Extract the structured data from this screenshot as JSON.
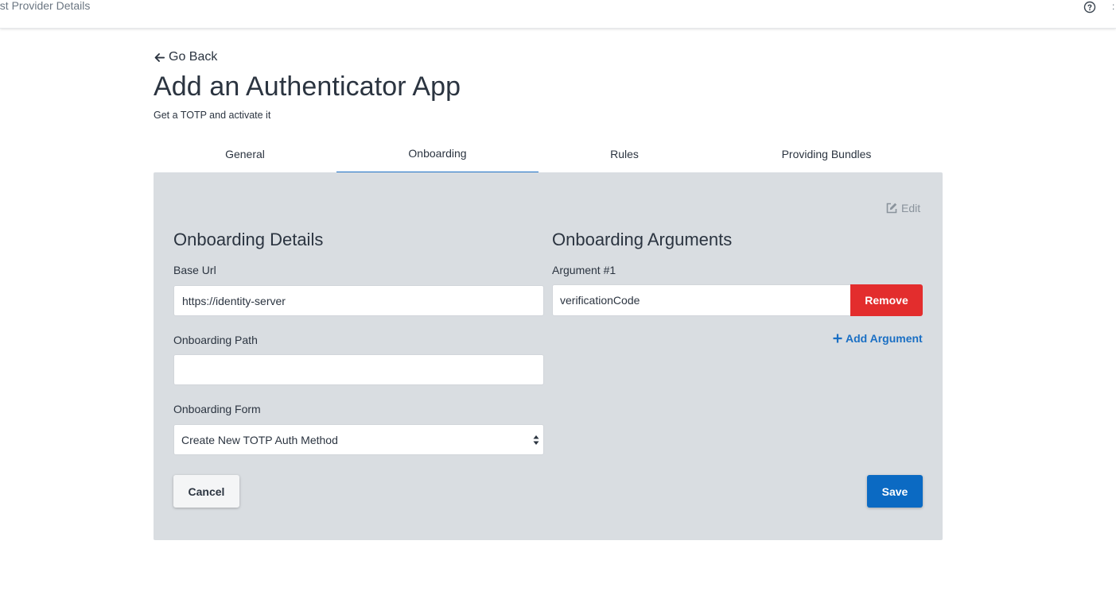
{
  "topbar": {
    "title": "ust Provider Details",
    "help_icon": "question-circle-icon",
    "edge_glyph": ":"
  },
  "header": {
    "go_back_label": "Go Back",
    "title": "Add an Authenticator App",
    "subtitle": "Get a TOTP and activate it"
  },
  "tabs": [
    {
      "label": "General",
      "active": false
    },
    {
      "label": "Onboarding",
      "active": true
    },
    {
      "label": "Rules",
      "active": false
    },
    {
      "label": "Providing Bundles",
      "active": false
    }
  ],
  "panel": {
    "edit_label": "Edit",
    "details": {
      "title": "Onboarding Details",
      "base_url_label": "Base Url",
      "base_url_value": "https://identity-server",
      "onboarding_path_label": "Onboarding Path",
      "onboarding_path_value": "",
      "onboarding_form_label": "Onboarding Form",
      "onboarding_form_value": "Create New TOTP Auth Method"
    },
    "arguments": {
      "title": "Onboarding Arguments",
      "items": [
        {
          "label": "Argument #1",
          "value": "verificationCode",
          "remove_label": "Remove"
        }
      ],
      "add_label": "Add Argument"
    },
    "cancel_label": "Cancel",
    "save_label": "Save"
  },
  "colors": {
    "accent": "#1a6fc4",
    "save": "#0b6ac3",
    "remove": "#e32d2d",
    "panel_bg": "#d9dde1",
    "text": "#2b3440"
  }
}
